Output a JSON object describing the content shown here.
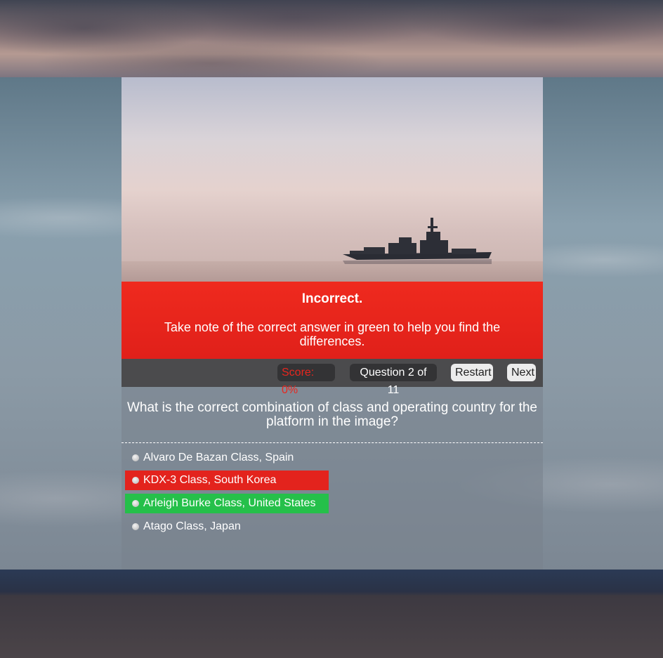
{
  "feedback": {
    "title": "Incorrect.",
    "message": "Take note of the correct answer in green to help you find the differences."
  },
  "toolbar": {
    "score": "Score: 0%",
    "question_count": "Question 2 of 11",
    "restart_label": "Restart",
    "next_label": "Next"
  },
  "question": {
    "text": "What is the correct combination of class and operating country for the platform in the image?"
  },
  "options": [
    {
      "label": "Alvaro De Bazan Class, Spain",
      "state": "neutral"
    },
    {
      "label": "KDX-3 Class, South Korea",
      "state": "incorrect"
    },
    {
      "label": "Arleigh Burke Class, United States",
      "state": "correct"
    },
    {
      "label": "Atago Class, Japan",
      "state": "neutral"
    }
  ],
  "colors": {
    "incorrect": "#e3231d",
    "correct": "#25c04a",
    "score_text": "#e8261e"
  }
}
